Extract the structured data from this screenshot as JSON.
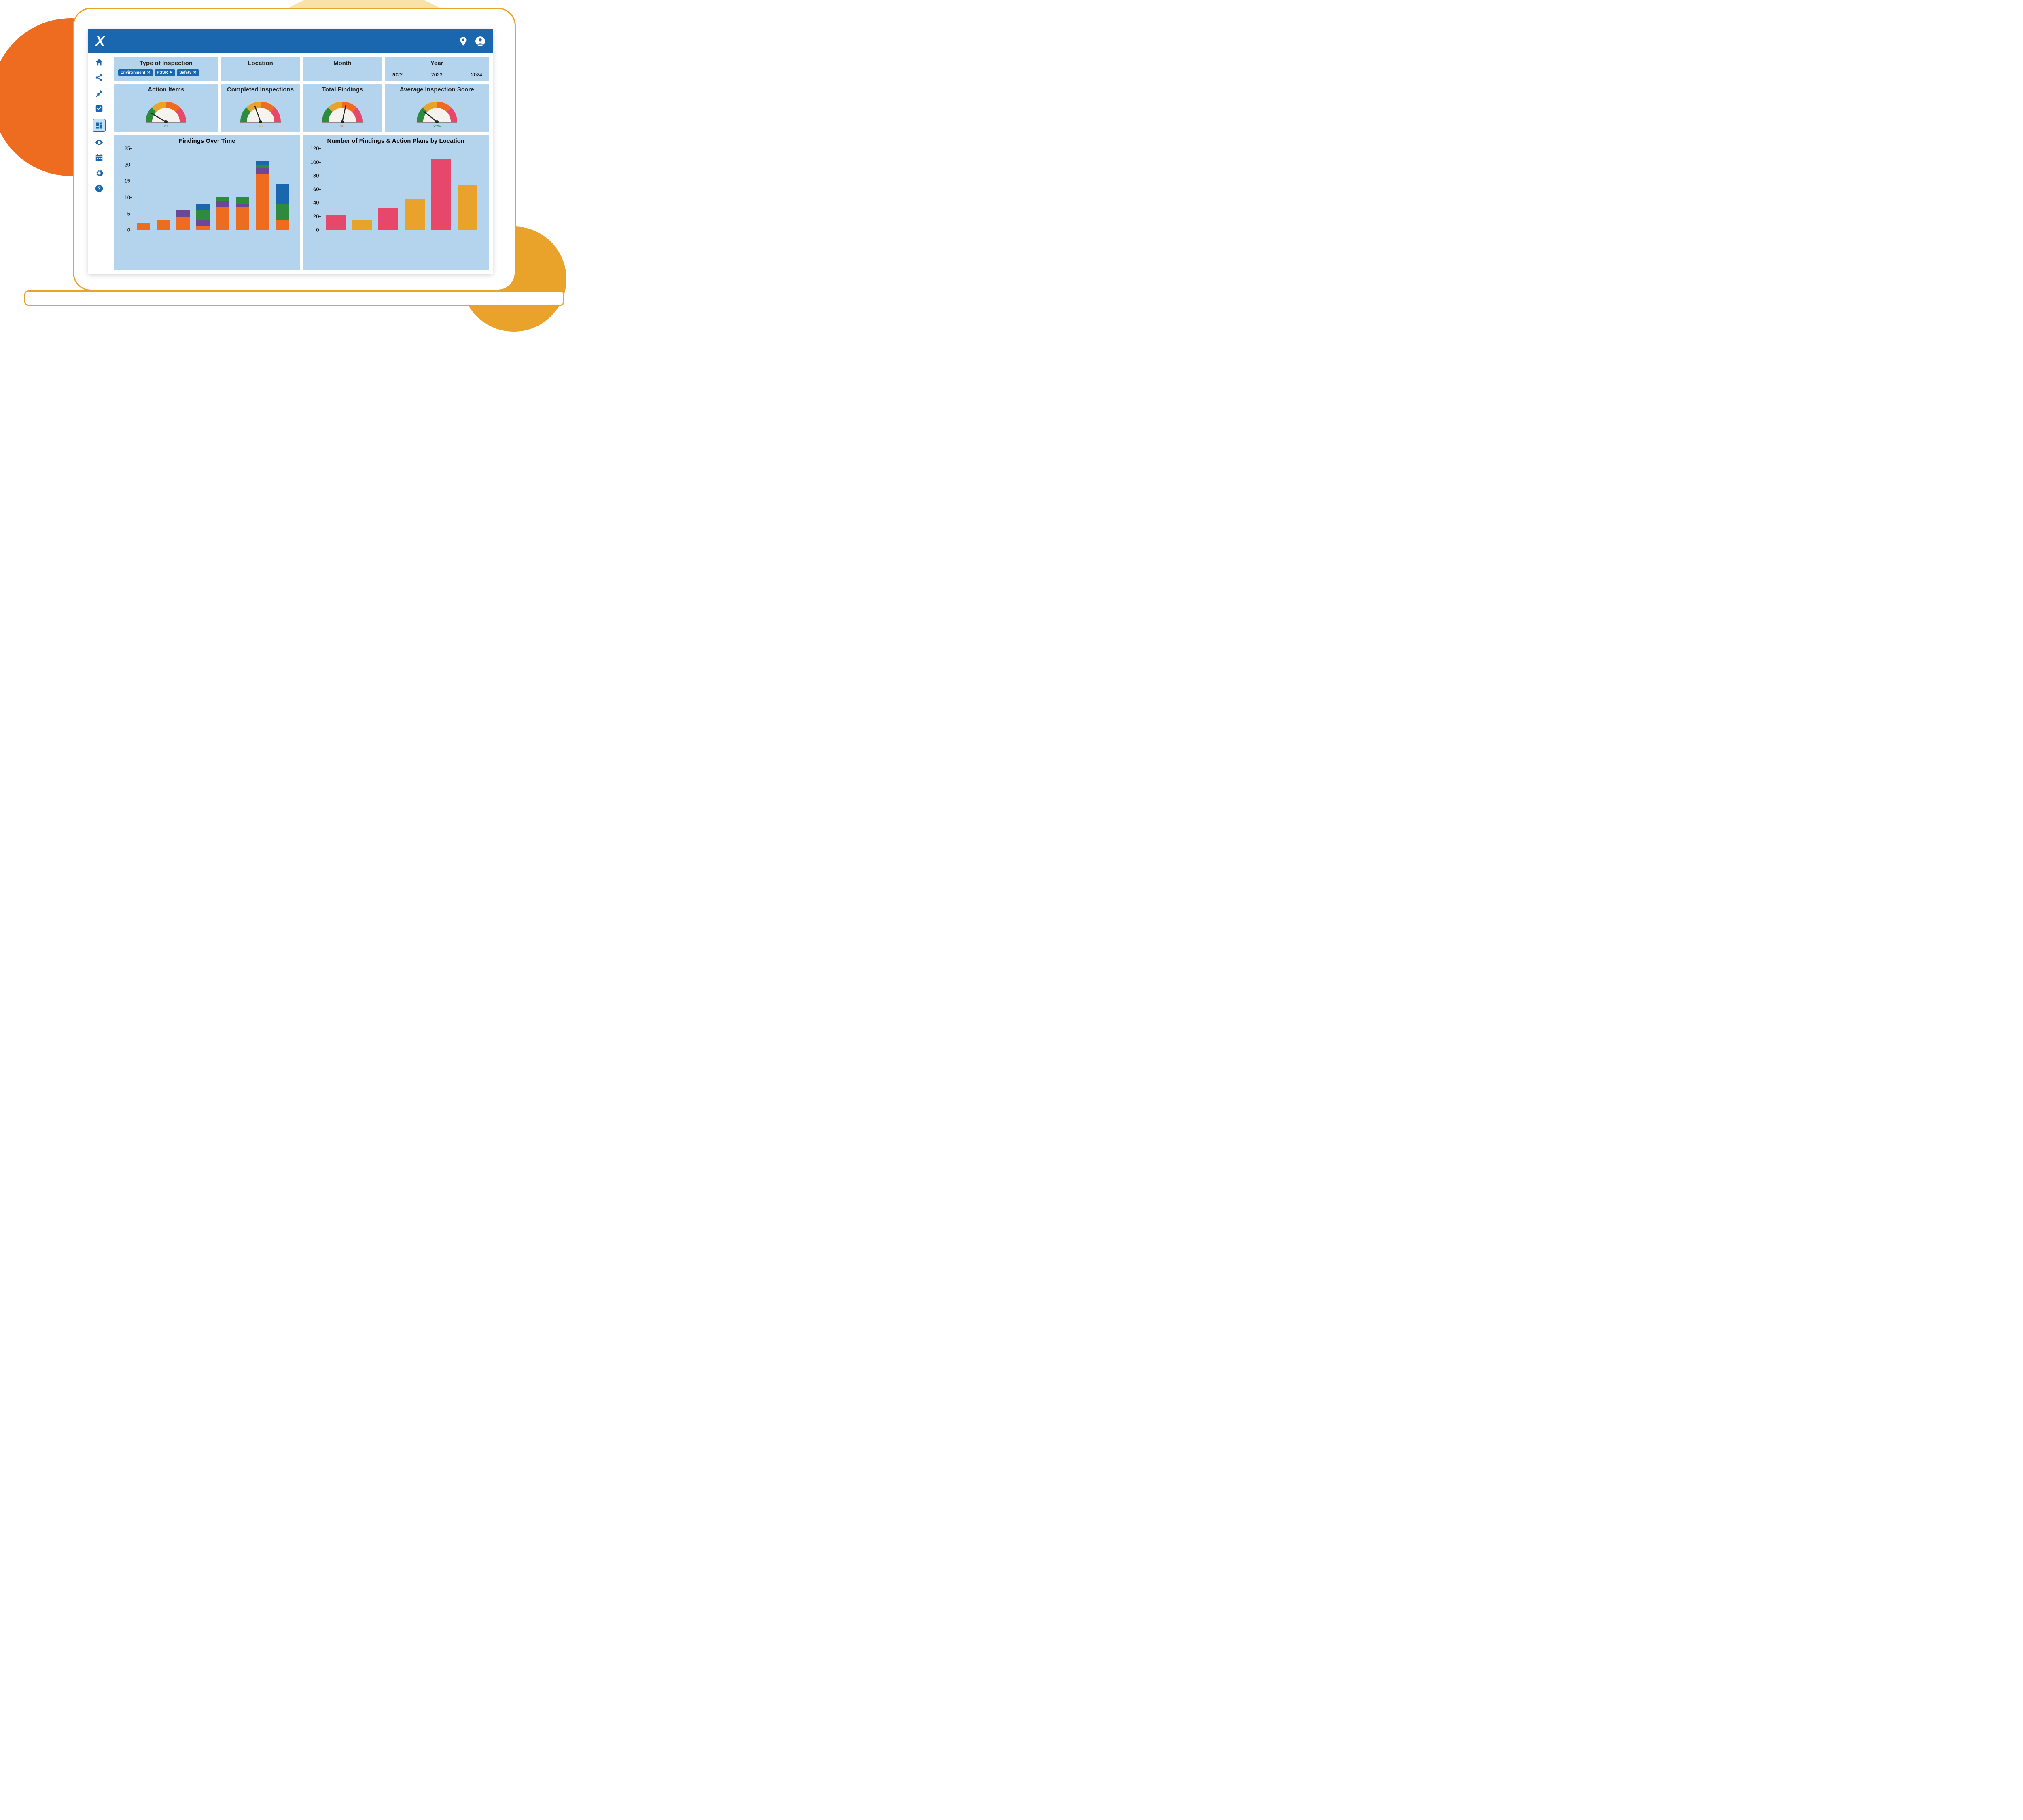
{
  "colors": {
    "brand": "#1A67AF",
    "tile_bg": "#B3D4EC",
    "green": "#2E8B3D",
    "yellow": "#E9A32B",
    "orange": "#ED6C20",
    "red": "#E7476B",
    "blue": "#1A67AF",
    "purple": "#6D4696"
  },
  "topbar": {
    "logo_text": "X"
  },
  "filters": {
    "type_label": "Type of Inspection",
    "type_chips": [
      "Environment",
      "PSSR",
      "Safety"
    ],
    "location_label": "Location",
    "month_label": "Month",
    "year_label": "Year",
    "years": [
      "2022",
      "2023",
      "2024"
    ]
  },
  "gauges": {
    "action_items": {
      "label": "Action Items",
      "value": "21",
      "angle": -60,
      "value_class": "gauge-value-green"
    },
    "completed": {
      "label": "Completed Inspections",
      "value": "40",
      "angle": -20,
      "value_class": "gauge-value-yellow"
    },
    "total_findings": {
      "label": "Total Findings",
      "value": "56",
      "angle": 12,
      "value_class": "gauge-value-orange"
    },
    "avg_score": {
      "label": "Average Inspection Score",
      "value": "25%",
      "angle": -52,
      "value_class": "gauge-value-green"
    }
  },
  "chart_data": [
    {
      "type": "bar",
      "title": "Findings Over Time",
      "ylim": [
        0,
        25
      ],
      "yticks": [
        0,
        5,
        10,
        15,
        20,
        25
      ],
      "categories": [
        "",
        "",
        "",
        "",
        "",
        "",
        "",
        ""
      ],
      "stacked": true,
      "series": [
        {
          "name": "orange",
          "color": "#ED6C20",
          "values": [
            2,
            3,
            4,
            1,
            7,
            7,
            17,
            3
          ]
        },
        {
          "name": "purple",
          "color": "#6D4696",
          "values": [
            0,
            0,
            2,
            2,
            2,
            1,
            2,
            0
          ]
        },
        {
          "name": "green",
          "color": "#2E8B3D",
          "values": [
            0,
            0,
            0,
            3,
            1,
            2,
            1,
            5
          ]
        },
        {
          "name": "blue",
          "color": "#1A67AF",
          "values": [
            0,
            0,
            0,
            2,
            0,
            0,
            1,
            6
          ]
        }
      ]
    },
    {
      "type": "bar",
      "title": "Number of Findings & Action Plans by Location",
      "ylim": [
        0,
        120
      ],
      "yticks": [
        0,
        20,
        40,
        60,
        80,
        100,
        120
      ],
      "categories": [
        "",
        "",
        "",
        "",
        "",
        ""
      ],
      "stacked": false,
      "series": [
        {
          "name": "pair",
          "colors": [
            "#E7476B",
            "#E9A32B",
            "#E7476B",
            "#E9A32B",
            "#E7476B",
            "#E9A32B"
          ],
          "values": [
            22,
            14,
            32,
            45,
            105,
            66
          ]
        }
      ]
    }
  ]
}
